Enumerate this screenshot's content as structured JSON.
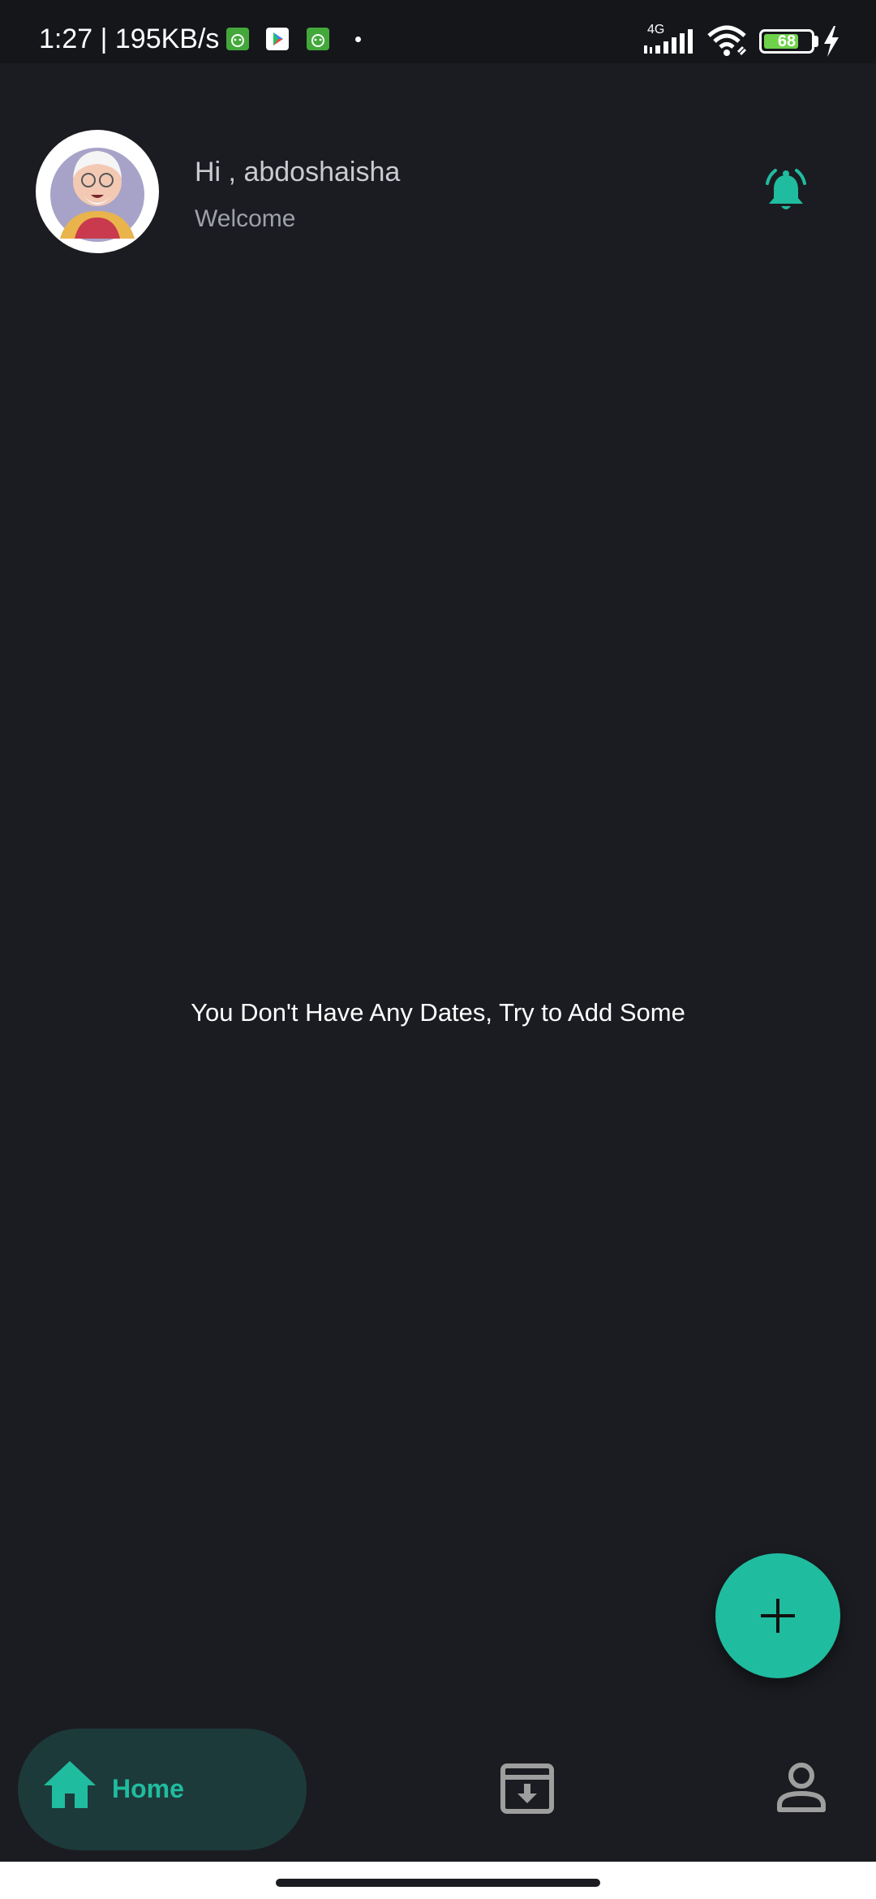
{
  "status_bar": {
    "time_speed": "1:27 | 195KB/s",
    "network": "4G",
    "battery": "68"
  },
  "header": {
    "greeting": "Hi , abdoshaisha",
    "subtitle": "Welcome"
  },
  "main": {
    "empty_message": "You Don't Have Any Dates, Try to Add Some"
  },
  "bottom_nav": {
    "items": [
      {
        "label": "Home",
        "icon": "home-icon",
        "active": true
      },
      {
        "label": "",
        "icon": "archive-icon",
        "active": false
      },
      {
        "label": "",
        "icon": "person-icon",
        "active": false
      }
    ]
  },
  "colors": {
    "background": "#1b1c21",
    "accent": "#20bc9f",
    "nav_active_bg": "#1d3a3a",
    "muted_text": "#9ea1a8"
  }
}
